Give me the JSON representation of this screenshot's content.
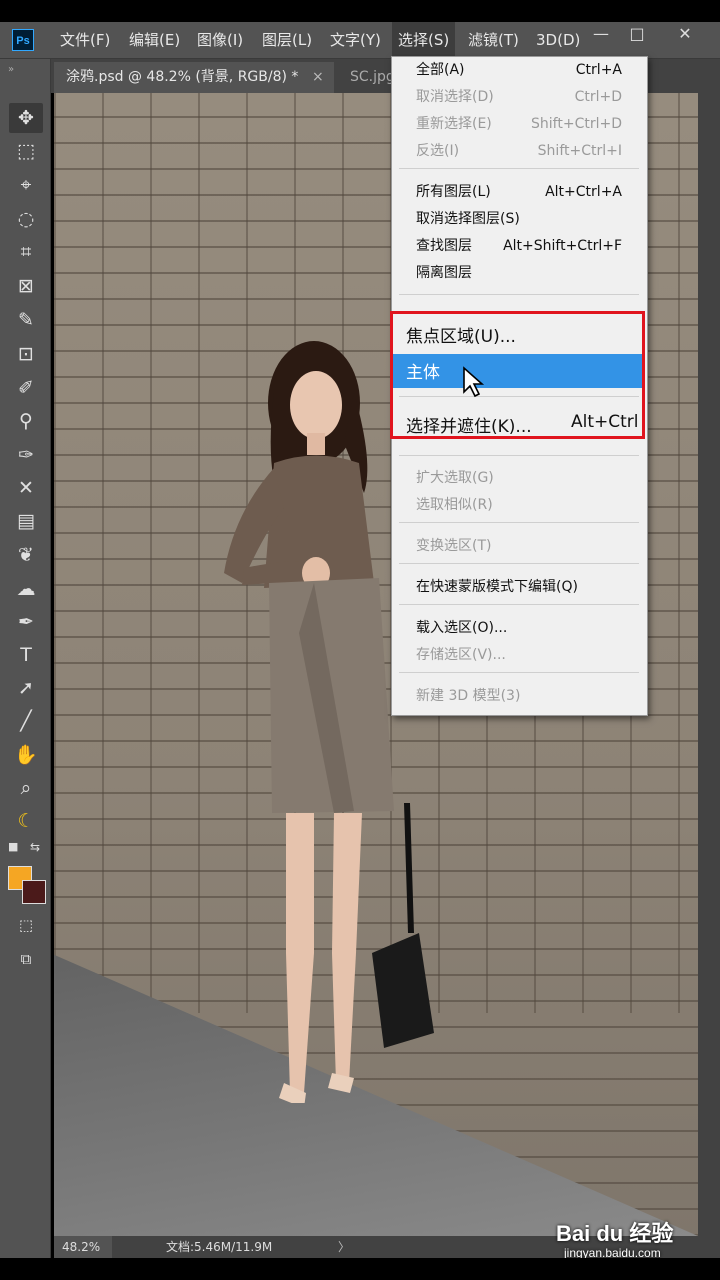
{
  "app": {
    "logo": "Ps"
  },
  "menubar": {
    "items": [
      "文件(F)",
      "编辑(E)",
      "图像(I)",
      "图层(L)",
      "文字(Y)",
      "选择(S)",
      "滤镜(T)",
      "3D(D)"
    ],
    "active": "选择(S)"
  },
  "window_controls": {
    "minimize": "—",
    "restore": "□",
    "close": "✕"
  },
  "tabs": [
    {
      "label": "涂鸦.psd @ 48.2% (背景, RGB/8) *",
      "close": "×"
    },
    {
      "label": "SC.jpg"
    }
  ],
  "toolbar": {
    "grip": "»",
    "tools": [
      "move-icon",
      "marquee-icon",
      "lasso-icon",
      "quick-select-icon",
      "crop-icon",
      "frame-icon",
      "eyedropper-icon",
      "patch-icon",
      "brush-icon",
      "stamp-icon",
      "history-brush-icon",
      "eraser-icon",
      "gradient-icon",
      "blur-icon",
      "dodge-icon",
      "pen-icon",
      "type-icon",
      "path-select-icon",
      "line-icon",
      "hand-icon",
      "zoom-icon",
      "banana-icon"
    ],
    "glyphs": [
      "✥",
      "⬚",
      "⌖",
      "◌",
      "⌗",
      "⊠",
      "✎",
      "⊡",
      "✐",
      "⚲",
      "✑",
      "✕",
      "▤",
      "❦",
      "☁",
      "✒",
      "T",
      "➚",
      "╱",
      "✋",
      "⌕",
      "☾"
    ],
    "fg_color": "#f5a623",
    "bg_color": "#4b1a1a"
  },
  "dropdown": {
    "groups": [
      [
        {
          "label": "全部(A)",
          "shortcut": "Ctrl+A",
          "enabled": true
        },
        {
          "label": "取消选择(D)",
          "shortcut": "Ctrl+D",
          "enabled": false
        },
        {
          "label": "重新选择(E)",
          "shortcut": "Shift+Ctrl+D",
          "enabled": false
        },
        {
          "label": "反选(I)",
          "shortcut": "Shift+Ctrl+I",
          "enabled": false
        }
      ],
      [
        {
          "label": "所有图层(L)",
          "shortcut": "Alt+Ctrl+A",
          "enabled": true
        },
        {
          "label": "取消选择图层(S)",
          "shortcut": "",
          "enabled": true
        },
        {
          "label": "查找图层",
          "shortcut": "Alt+Shift+Ctrl+F",
          "enabled": true
        },
        {
          "label": "隔离图层",
          "shortcut": "",
          "enabled": true
        }
      ],
      [
        {
          "label": "扩大选取(G)",
          "shortcut": "",
          "enabled": false
        },
        {
          "label": "选取相似(R)",
          "shortcut": "",
          "enabled": false
        }
      ],
      [
        {
          "label": "变换选区(T)",
          "shortcut": "",
          "enabled": false
        }
      ],
      [
        {
          "label": "在快速蒙版模式下编辑(Q)",
          "shortcut": "",
          "enabled": true
        }
      ],
      [
        {
          "label": "载入选区(O)...",
          "shortcut": "",
          "enabled": true
        },
        {
          "label": "存储选区(V)...",
          "shortcut": "",
          "enabled": false
        }
      ],
      [
        {
          "label": "新建 3D 模型(3)",
          "shortcut": "",
          "enabled": false
        }
      ]
    ],
    "zoomed": {
      "item1": "焦点区域(U)...",
      "item2": "主体",
      "item3": "选择并遮住(K)...",
      "item3_shortcut": "Alt+Ctrl",
      "highlight_color": "#3393e6",
      "border_color": "#e0141e"
    }
  },
  "statusbar": {
    "zoom": "48.2%",
    "doc": "文档:5.46M/11.9M",
    "arrow": "〉"
  },
  "watermark": {
    "brand": "Bai du 经验",
    "url": "jingyan.baidu.com"
  }
}
